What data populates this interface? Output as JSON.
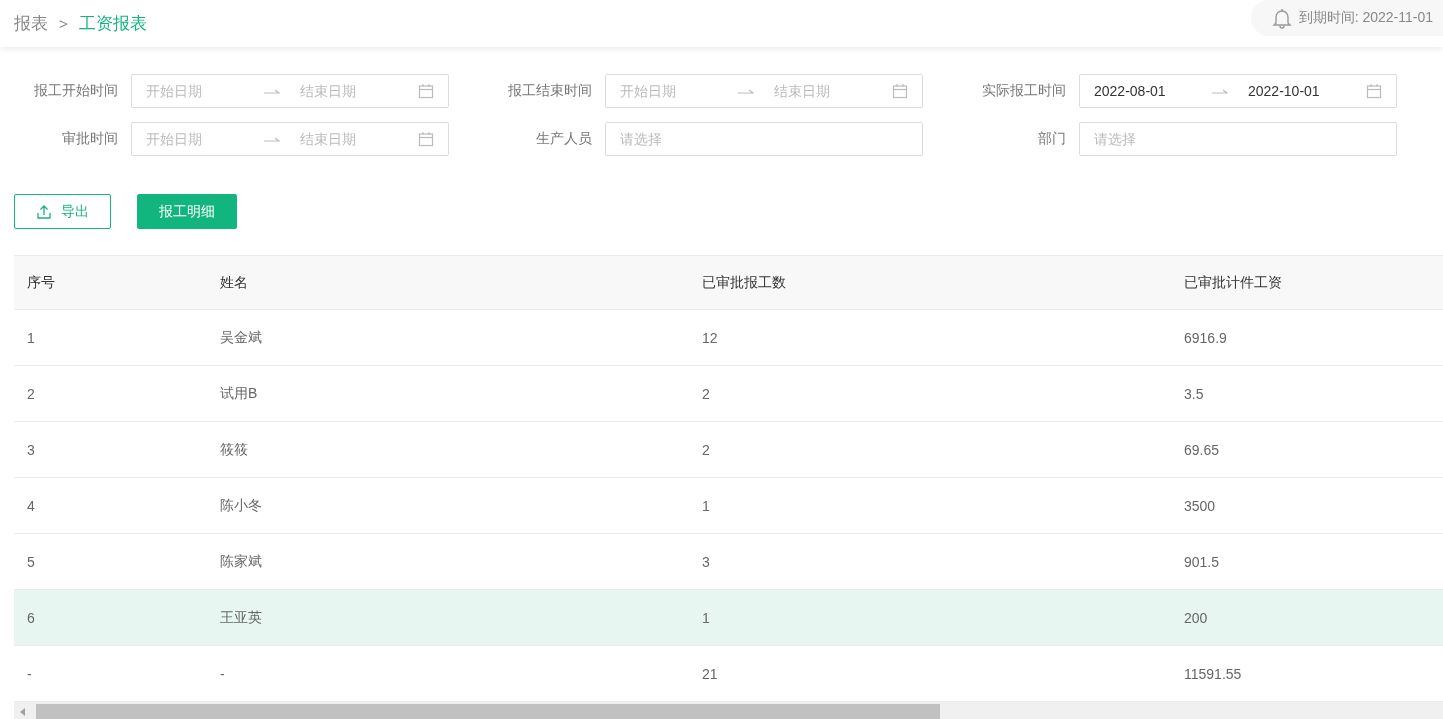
{
  "breadcrumb": [
    {
      "label": "报表",
      "selected": false
    },
    {
      "label": "工资报表",
      "selected": true
    }
  ],
  "breadcrumb_separator": ">",
  "expiry": "到期时间: 2022-11-01",
  "filters": [
    {
      "kind": "date_range",
      "label": "报工开始时间",
      "start": {
        "placeholder": "开始日期"
      },
      "end": {
        "placeholder": "结束日期"
      }
    },
    {
      "kind": "date_range",
      "label": "报工结束时间",
      "start": {
        "placeholder": "开始日期"
      },
      "end": {
        "placeholder": "结束日期"
      }
    },
    {
      "kind": "date_range",
      "label": "实际报工时间",
      "start": {
        "value": "2022-08-01"
      },
      "end": {
        "value": "2022-10-01"
      }
    },
    {
      "kind": "date_range",
      "label": "审批时间",
      "start": {
        "placeholder": "开始日期"
      },
      "end": {
        "placeholder": "结束日期"
      }
    },
    {
      "kind": "select",
      "label": "生产人员",
      "placeholder": "请选择"
    },
    {
      "kind": "select",
      "label": "部门",
      "placeholder": "请选择"
    }
  ],
  "buttons": [
    {
      "kind": "outline",
      "label": "导出"
    },
    {
      "kind": "primary",
      "label": "报工明细"
    }
  ],
  "table": {
    "columns": [
      "序号",
      "姓名",
      "已审批报工数",
      "已审批计件工资"
    ],
    "rows": [
      {
        "cells": [
          "1",
          "吴金斌",
          "12",
          "6916.9"
        ],
        "selected": false
      },
      {
        "cells": [
          "2",
          "试用B",
          "2",
          "3.5"
        ],
        "selected": false
      },
      {
        "cells": [
          "3",
          "筱筱",
          "2",
          "69.65"
        ],
        "selected": false
      },
      {
        "cells": [
          "4",
          "陈小冬",
          "1",
          "3500"
        ],
        "selected": false
      },
      {
        "cells": [
          "5",
          "陈家斌",
          "3",
          "901.5"
        ],
        "selected": false
      },
      {
        "cells": [
          "6",
          "王亚英",
          "1",
          "200"
        ],
        "selected": true
      }
    ],
    "total_row": [
      "-",
      "-",
      "21",
      "11591.55"
    ]
  }
}
